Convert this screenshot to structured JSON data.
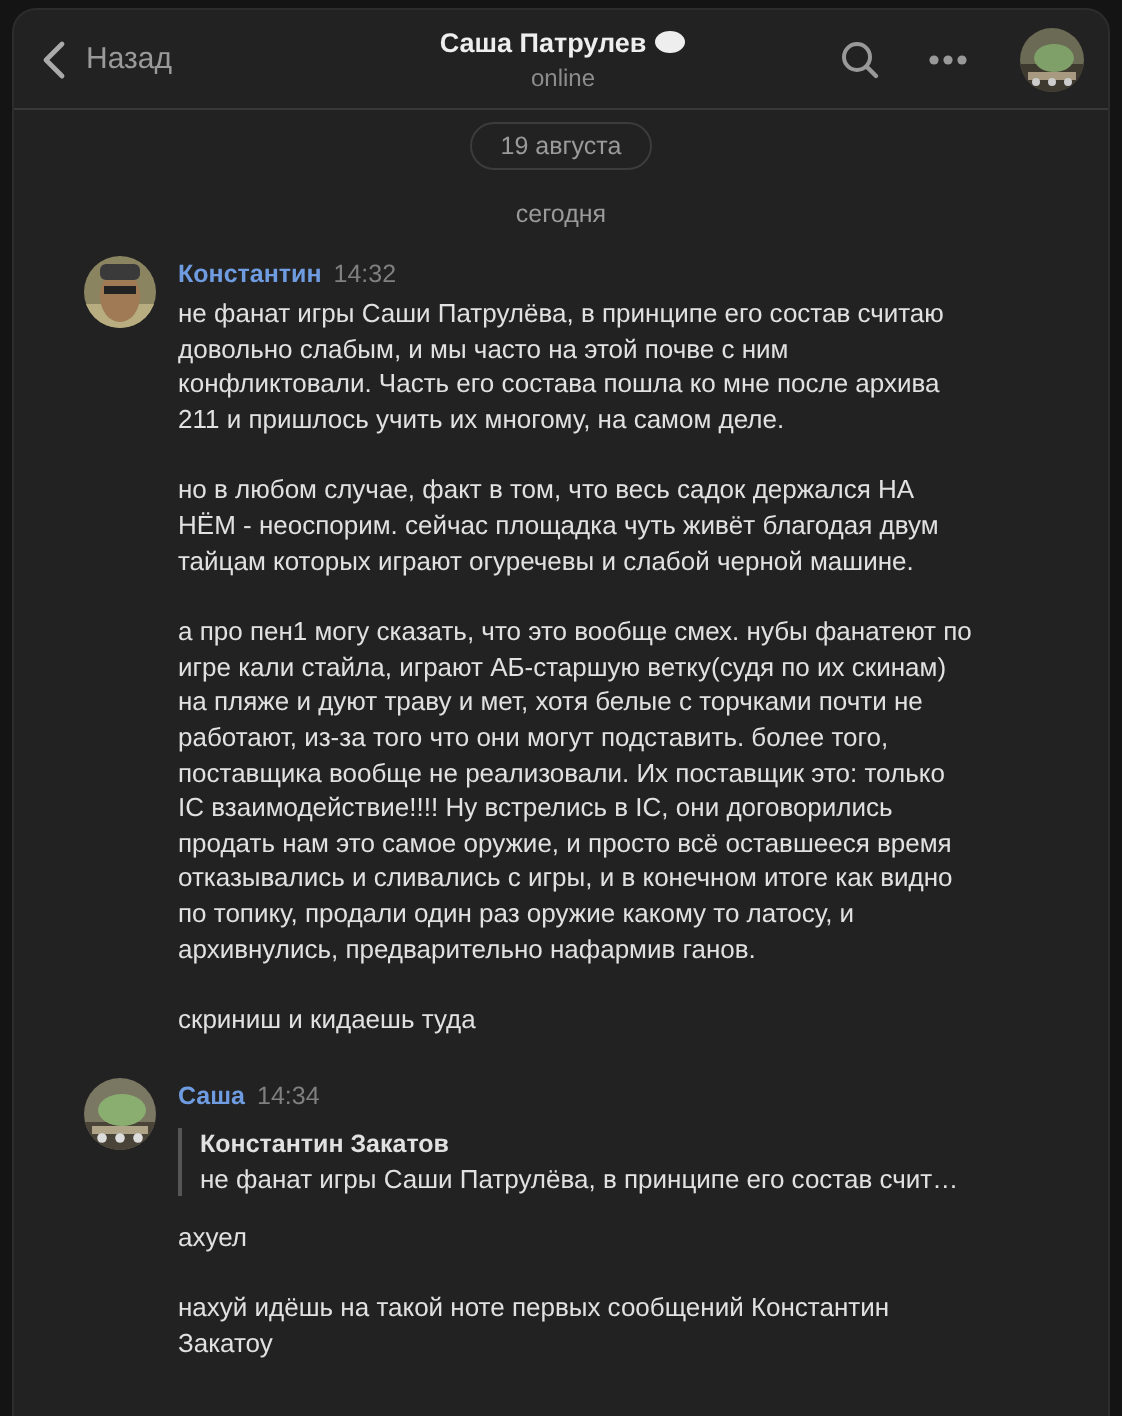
{
  "header": {
    "back": "Назад",
    "title": "Саша Патрулев",
    "status": "online"
  },
  "date_pill": "19 августа",
  "day_label": "сегодня",
  "messages": [
    {
      "author": "Константин",
      "time": "14:32",
      "paragraphs": [
        "не фанат игры Саши Патрулёва, в принципе его состав считаю довольно слабым, и мы часто на этой почве с ним конфликтовали. Часть его состава пошла ко мне после архива 211 и пришлось учить их многому, на самом деле.",
        "но в любом случае, факт в том, что весь садок держался НА НЁМ - неоспорим. сейчас площадка чуть живёт благодая двум тайцам которых играют огуречевы и слабой черной машине.",
        "а про пен1 могу сказать, что это вообще смех. нубы фанатеют по игре кали стайла, играют АБ-старшую ветку(судя по их скинам) на пляже и дуют траву и мет, хотя белые с торчками почти не работают, из-за того что они могут подставить. более того, поставщика вообще не реализовали. Их поставщик это: только IC взаимодействие!!!! Ну встрелись в IC, они договорились продать нам это самое оружие, и просто всё оставшееся время отказывались и сливались с игры, и в конечном итоге как видно по топику, продали один раз оружие какому то латосу, и архивнулись, предварительно нафармив ганов.",
        "скриниш и кидаешь туда"
      ]
    },
    {
      "author": "Саша",
      "time": "14:34",
      "reply": {
        "author": "Константин Закатов",
        "text": "не фанат игры Саши Патрулёва, в принципе его состав счит…"
      },
      "paragraphs": [
        "ахуел",
        "нахуй идёшь на такой ноте первых сообщений Константин Закатоу"
      ]
    }
  ]
}
